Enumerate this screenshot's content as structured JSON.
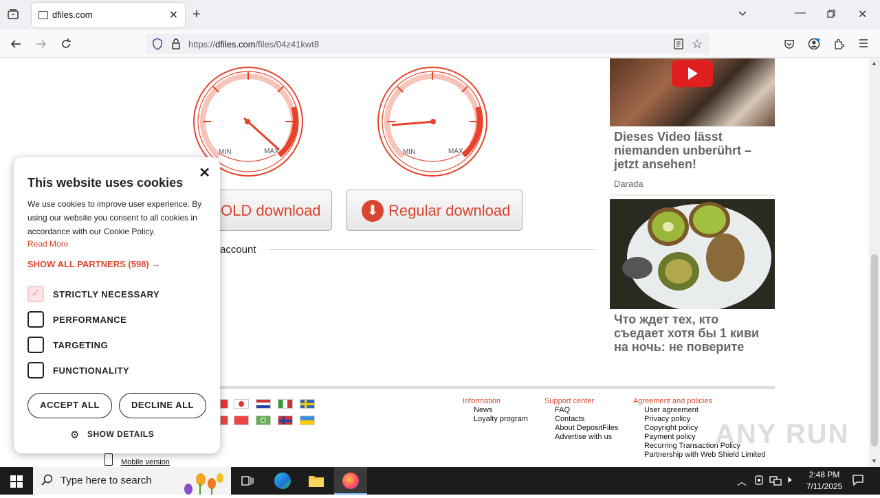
{
  "browser": {
    "tab_title": "dfiles.com",
    "url_prefix": "https://",
    "url_host": "dfiles.com",
    "url_path": "/files/04z41kwt8"
  },
  "gauges": [
    {
      "min_label": "MIN",
      "max_label": "MAX"
    },
    {
      "min_label": "MIN",
      "max_label": "MAX"
    }
  ],
  "downloads": {
    "gold_label": "OLD download",
    "regular_label": "Regular download",
    "account_text": "account"
  },
  "ads": [
    {
      "title": "Dieses Video lässt niemanden unberührt – jetzt ansehen!",
      "source": "Darada"
    },
    {
      "title": "Что ждет тех, кто съедает хотя бы 1 киви на ночь: не поверите"
    }
  ],
  "footer": {
    "information": {
      "heading": "Information",
      "links": [
        "News",
        "Loyalty program"
      ]
    },
    "support": {
      "heading": "Support center",
      "links": [
        "FAQ",
        "Contacts",
        "About DepositFiles",
        "Advertise with us"
      ]
    },
    "agreement": {
      "heading": "Agreement and policies",
      "links": [
        "User agreement",
        "Privacy policy",
        "Copyright policy",
        "Payment policy",
        "Recurring Transaction Policy",
        "Partnership with Web Shield Limited"
      ]
    },
    "mobile_version": "Mobile version",
    "watermark": "ANY RUN"
  },
  "cookie": {
    "title": "This website uses cookies",
    "body": "We use cookies to improve user experience. By using our website you consent to all cookies in accordance with our Cookie Policy.",
    "read_more": "Read More",
    "show_partners": "SHOW ALL PARTNERS (598) →",
    "options": [
      {
        "label": "STRICTLY NECESSARY",
        "checked": true
      },
      {
        "label": "PERFORMANCE",
        "checked": false
      },
      {
        "label": "TARGETING",
        "checked": false
      },
      {
        "label": "FUNCTIONALITY",
        "checked": false
      }
    ],
    "accept": "ACCEPT ALL",
    "decline": "DECLINE ALL",
    "details": "SHOW DETAILS"
  },
  "taskbar": {
    "search_placeholder": "Type here to search",
    "time": "2:48 PM",
    "date": "7/11/2025"
  },
  "colors": {
    "accent": "#d9462f",
    "gauge": "#e8432a"
  }
}
